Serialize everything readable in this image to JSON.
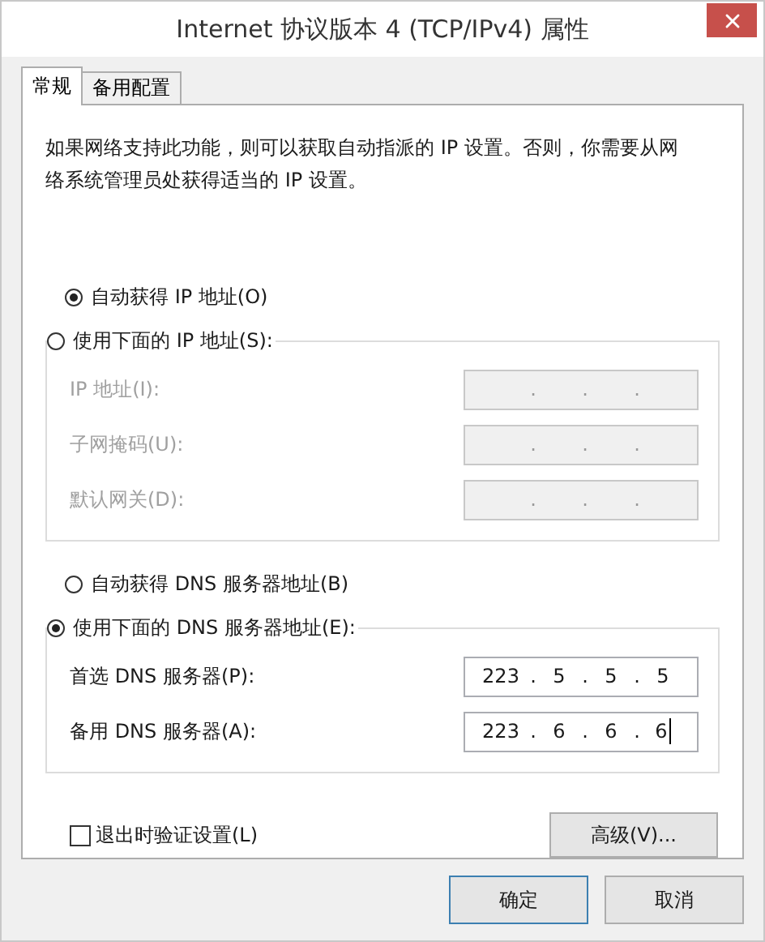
{
  "window": {
    "title": "Internet 协议版本 4 (TCP/IPv4) 属性"
  },
  "tabs": [
    {
      "label": "常规",
      "selected": true
    },
    {
      "label": "备用配置",
      "selected": false
    }
  ],
  "description": "如果网络支持此功能，则可以获取自动指派的 IP 设置。否则，你需要从网络系统管理员处获得适当的 IP 设置。",
  "sections": [
    {
      "auto_option": {
        "label": "自动获得 IP 地址(O)",
        "selected": true
      },
      "manual_option": {
        "label": "使用下面的 IP 地址(S):",
        "selected": false
      },
      "fields": [
        {
          "label": "IP 地址(I):",
          "disabled": true,
          "dots": [
            ".",
            ".",
            "."
          ]
        },
        {
          "label": "子网掩码(U):",
          "disabled": true,
          "dots": [
            ".",
            ".",
            "."
          ]
        },
        {
          "label": "默认网关(D):",
          "disabled": true,
          "dots": [
            ".",
            ".",
            "."
          ]
        }
      ]
    },
    {
      "auto_option": {
        "label": "自动获得 DNS 服务器地址(B)",
        "selected": false
      },
      "manual_option": {
        "label": "使用下面的 DNS 服务器地址(E):",
        "selected": true
      },
      "fields": [
        {
          "label": "首选 DNS 服务器(P):",
          "disabled": false,
          "octets": [
            "223",
            "5",
            "5",
            "5"
          ],
          "dots": [
            ".",
            ".",
            "."
          ]
        },
        {
          "label": "备用 DNS 服务器(A):",
          "disabled": false,
          "focused": true,
          "octets": [
            "223",
            "6",
            "6",
            "6"
          ],
          "dots": [
            ".",
            ".",
            "."
          ]
        }
      ]
    }
  ],
  "checkbox": {
    "label": "退出时验证设置(L)",
    "checked": false
  },
  "advanced_button": "高级(V)...",
  "buttons": [
    {
      "label": "确定",
      "kind": "default"
    },
    {
      "label": "取消",
      "kind": "normal"
    }
  ]
}
